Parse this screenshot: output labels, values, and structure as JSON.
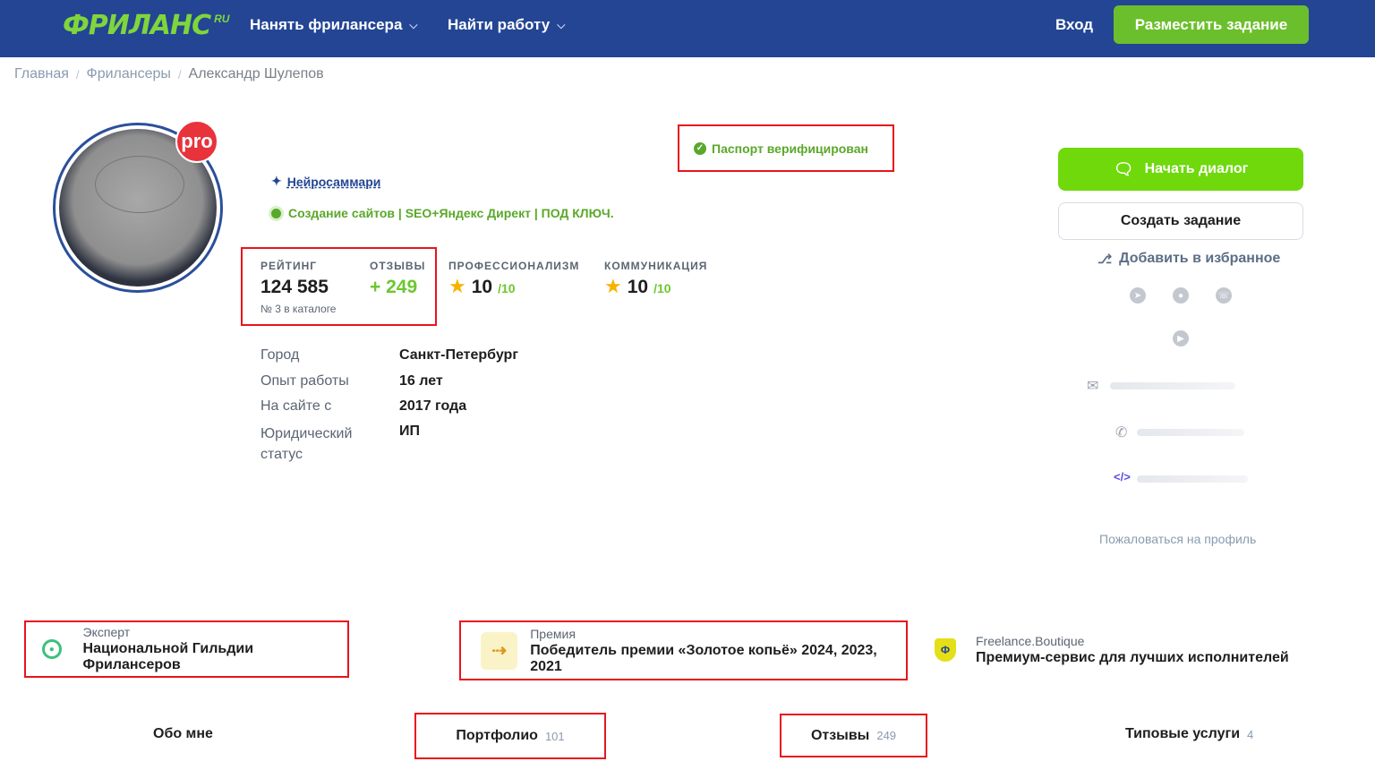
{
  "header": {
    "logo": "ФРИЛАНС",
    "logo_suffix": "RU",
    "nav": [
      {
        "label": "Нанять фрилансера"
      },
      {
        "label": "Найти работу"
      }
    ],
    "login": "Вход",
    "post_task": "Разместить задание"
  },
  "breadcrumb": {
    "items": [
      "Главная",
      "Фрилансеры"
    ],
    "current": "Александр Шулепов",
    "separator": "/"
  },
  "profile": {
    "pro_badge": "pro",
    "verified": "Паспорт верифицирован",
    "neuro_summary": "Нейросаммари",
    "specialization": "Создание сайтов | SEO+Яндекс Директ | ПОД КЛЮЧ."
  },
  "stats": {
    "rating_label": "РЕЙТИНГ",
    "rating_value": "124 585",
    "rating_sub": "№ 3 в каталоге",
    "reviews_label": "ОТЗЫВЫ",
    "reviews_value": "+ 249",
    "prof_label": "ПРОФЕССИОНАЛИЗМ",
    "prof_value": "10",
    "prof_of": "/10",
    "comm_label": "КОММУНИКАЦИЯ",
    "comm_value": "10",
    "comm_of": "/10"
  },
  "info": [
    {
      "key": "Город",
      "value": "Санкт-Петербург"
    },
    {
      "key": "Опыт работы",
      "value": "16 лет"
    },
    {
      "key": "На сайте с",
      "value": "2017 года"
    },
    {
      "key": "Юридический статус",
      "value": "ИП"
    }
  ],
  "sidebar": {
    "start_dialog": "Начать диалог",
    "create_task": "Создать задание",
    "add_favorite": "Добавить в избранное",
    "complain": "Пожаловаться на профиль"
  },
  "badges": [
    {
      "subtitle": "Эксперт",
      "title": "Национальной Гильдии Фрилансеров",
      "icon": "guild-icon"
    },
    {
      "subtitle": "Премия",
      "title": "Победитель премии «Золотое копьё» 2024, 2023, 2021",
      "icon": "golden-spear-icon"
    },
    {
      "subtitle": "Freelance.Boutique",
      "title": "Премиум-сервис для лучших исполнителей",
      "icon": "boutique-shield-icon"
    }
  ],
  "tabs": [
    {
      "label": "Обо мне",
      "count": ""
    },
    {
      "label": "Портфолио",
      "count": "101"
    },
    {
      "label": "Отзывы",
      "count": "249"
    },
    {
      "label": "Типовые услуги",
      "count": "4"
    }
  ],
  "colors": {
    "header_bg": "#234594",
    "accent_green": "#6cbf2c",
    "dialog_green": "#6fd90c",
    "highlight_red": "#e8141c",
    "pro_red": "#e8323c"
  }
}
